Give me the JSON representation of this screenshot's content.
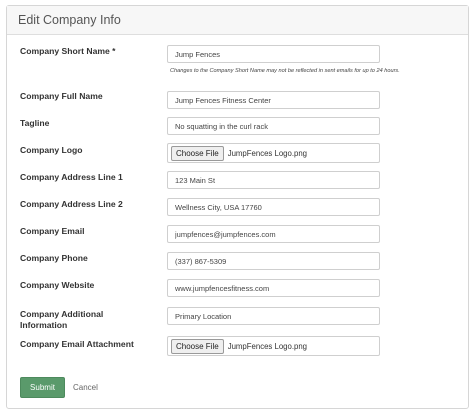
{
  "panel": {
    "title": "Edit Company Info"
  },
  "fields": {
    "short_name": {
      "label": "Company Short Name *",
      "value": "Jump Fences",
      "help": "Changes to the Company Short Name may not be reflected in sent emails for up to 24 hours."
    },
    "full_name": {
      "label": "Company Full Name",
      "value": "Jump Fences Fitness Center"
    },
    "tagline": {
      "label": "Tagline",
      "value": "No squatting in the curl rack"
    },
    "logo": {
      "label": "Company Logo",
      "button": "Choose File",
      "file": "JumpFences Logo.png"
    },
    "address1": {
      "label": "Company Address Line 1",
      "value": "123 Main St"
    },
    "address2": {
      "label": "Company Address Line 2",
      "value": "Wellness City, USA 17760"
    },
    "email": {
      "label": "Company Email",
      "value": "jumpfences@jumpfences.com"
    },
    "phone": {
      "label": "Company Phone",
      "value": "(337) 867-5309"
    },
    "website": {
      "label": "Company Website",
      "value": "www.jumpfencesfitness.com"
    },
    "additional": {
      "label": "Company Additional Information",
      "value": "Primary Location"
    },
    "attachment": {
      "label": "Company Email Attachment",
      "button": "Choose File",
      "file": "JumpFences Logo.png"
    }
  },
  "actions": {
    "submit": "Submit",
    "cancel": "Cancel"
  },
  "colors": {
    "submit_bg": "#5a9a6b",
    "header_bg": "#f7f7f7"
  }
}
